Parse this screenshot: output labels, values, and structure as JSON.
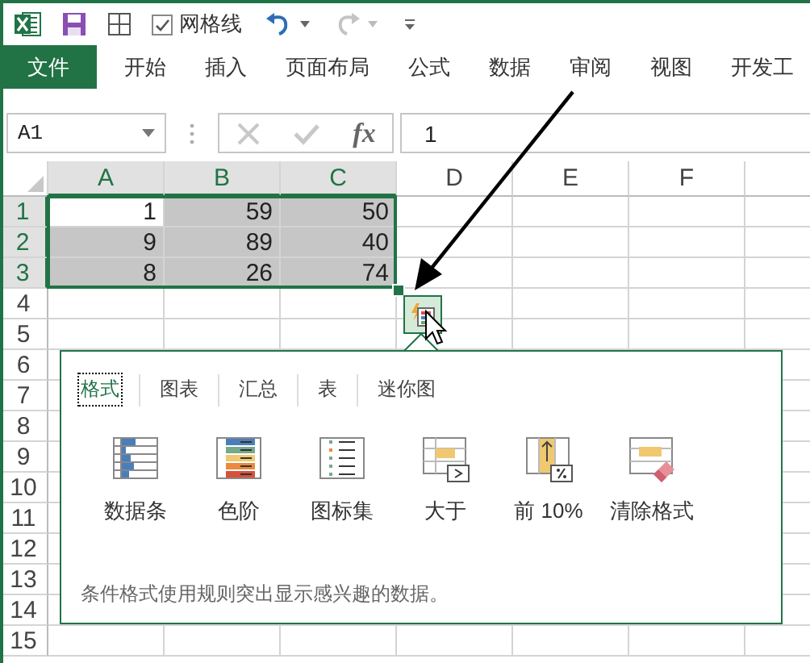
{
  "quick_access": {
    "gridlines": {
      "label": "网格线",
      "checked": true
    },
    "redo_disabled": true
  },
  "ribbon_tabs": [
    {
      "label": "文件",
      "kind": "file"
    },
    {
      "label": "开始",
      "kind": "tab"
    },
    {
      "label": "插入",
      "kind": "tab"
    },
    {
      "label": "页面布局",
      "kind": "tab"
    },
    {
      "label": "公式",
      "kind": "tab"
    },
    {
      "label": "数据",
      "kind": "tab"
    },
    {
      "label": "审阅",
      "kind": "tab"
    },
    {
      "label": "视图",
      "kind": "tab"
    },
    {
      "label": "开发工",
      "kind": "tab"
    }
  ],
  "formula_bar": {
    "name_box": "A1",
    "function_button": "fx",
    "value": "1"
  },
  "columns": [
    {
      "label": "A",
      "selected": true
    },
    {
      "label": "B",
      "selected": true
    },
    {
      "label": "C",
      "selected": true
    },
    {
      "label": "D",
      "selected": false
    },
    {
      "label": "E",
      "selected": false
    },
    {
      "label": "F",
      "selected": false
    }
  ],
  "rows": [
    {
      "label": "1",
      "selected": true,
      "cells": [
        {
          "value": "1",
          "selected": false
        },
        {
          "value": "59",
          "selected": true
        },
        {
          "value": "50",
          "selected": true
        }
      ]
    },
    {
      "label": "2",
      "selected": true,
      "cells": [
        {
          "value": "9",
          "selected": true
        },
        {
          "value": "89",
          "selected": true
        },
        {
          "value": "40",
          "selected": true
        }
      ]
    },
    {
      "label": "3",
      "selected": true,
      "cells": [
        {
          "value": "8",
          "selected": true
        },
        {
          "value": "26",
          "selected": true
        },
        {
          "value": "74",
          "selected": true
        }
      ]
    },
    {
      "label": "4",
      "selected": false,
      "cells": []
    },
    {
      "label": "5",
      "selected": false,
      "cells": []
    },
    {
      "label": "6",
      "selected": false,
      "cells": []
    },
    {
      "label": "7",
      "selected": false,
      "cells": []
    },
    {
      "label": "8",
      "selected": false,
      "cells": []
    },
    {
      "label": "9",
      "selected": false,
      "cells": []
    },
    {
      "label": "10",
      "selected": false,
      "cells": []
    },
    {
      "label": "11",
      "selected": false,
      "cells": []
    },
    {
      "label": "12",
      "selected": false,
      "cells": []
    },
    {
      "label": "13",
      "selected": false,
      "cells": []
    },
    {
      "label": "14",
      "selected": false,
      "cells": []
    },
    {
      "label": "15",
      "selected": false,
      "cells": []
    }
  ],
  "quick_analysis": {
    "tabs": [
      {
        "label": "格式",
        "selected": true
      },
      {
        "label": "图表",
        "selected": false
      },
      {
        "label": "汇总",
        "selected": false
      },
      {
        "label": "表",
        "selected": false
      },
      {
        "label": "迷你图",
        "selected": false
      }
    ],
    "items": [
      {
        "label": "数据条",
        "kind": "databar"
      },
      {
        "label": "色阶",
        "kind": "colorscale"
      },
      {
        "label": "图标集",
        "kind": "iconset"
      },
      {
        "label": "大于",
        "kind": "greater"
      },
      {
        "label": "前 10%",
        "kind": "top"
      },
      {
        "label": "清除格式",
        "kind": "clear"
      }
    ],
    "description": "条件格式使用规则突出显示感兴趣的数据。"
  }
}
